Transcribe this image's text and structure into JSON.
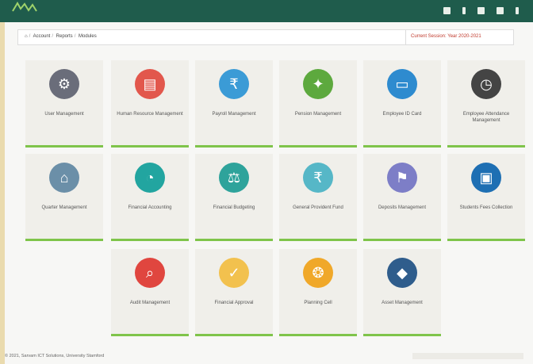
{
  "breadcrumb": [
    "⌂",
    "Account",
    "Reports",
    "Modules"
  ],
  "session_text": "Current Session: Year 2020-2021",
  "tiles": [
    {
      "label": "User Management",
      "icon": "gear-icon",
      "color": "#6a6d7a"
    },
    {
      "label": "Human Resource Management",
      "icon": "presentation-icon",
      "color": "#e2574c"
    },
    {
      "label": "Payroll Management",
      "icon": "payroll-icon",
      "color": "#3b9bd6"
    },
    {
      "label": "Pension Management",
      "icon": "handshake-icon",
      "color": "#5da93e"
    },
    {
      "label": "Employee ID Card",
      "icon": "id-card-icon",
      "color": "#2e8bcf"
    },
    {
      "label": "Employee Attendance Management",
      "icon": "clock-calendar-icon",
      "color": "#444444"
    },
    {
      "label": "Quarter Management",
      "icon": "house-icon",
      "color": "#6b8fa8"
    },
    {
      "label": "Financial Accounting",
      "icon": "accounting-icon",
      "color": "#22a5a0"
    },
    {
      "label": "Financial Budgeting",
      "icon": "budget-icon",
      "color": "#2ea39b"
    },
    {
      "label": "General Provident Fund",
      "icon": "rupee-bag-icon",
      "color": "#56b7c7"
    },
    {
      "label": "Deposits Management",
      "icon": "deposit-icon",
      "color": "#7d7ec7"
    },
    {
      "label": "Students Fees Collection",
      "icon": "fees-card-icon",
      "color": "#1e6fb3"
    },
    {
      "label": "Audit Management",
      "icon": "magnifier-icon",
      "color": "#e0463f"
    },
    {
      "label": "Financial Approval",
      "icon": "clipboard-check-icon",
      "color": "#f2c14e"
    },
    {
      "label": "Planning Cell",
      "icon": "network-gear-icon",
      "color": "#f0a829"
    },
    {
      "label": "Asset Management",
      "icon": "asset-cube-icon",
      "color": "#2f5d8c"
    }
  ],
  "footer_text": "© 2021, Sarvam ICT Solutions, University Stamford"
}
